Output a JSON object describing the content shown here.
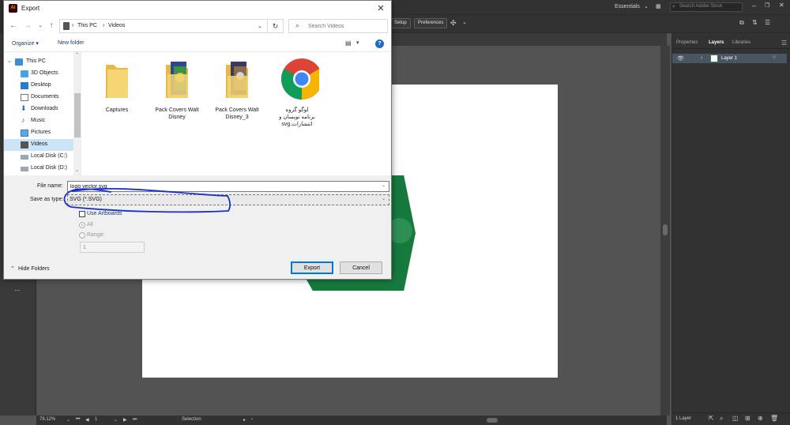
{
  "illustrator": {
    "workspace": "Essentials",
    "stock_search_placeholder": "Search Adobe Stock",
    "setup_btn": "Setup",
    "preferences_btn": "Preferences",
    "panel_tabs": [
      "Properties",
      "Layers",
      "Libraries"
    ],
    "layer_name": "Layer 1",
    "layer_count": "1 Layer",
    "zoom": "79.12%",
    "artboard_num": "1",
    "status_tool": "Selection",
    "toolbar_more": "...",
    "colors": {
      "shape_green": "#167a3e",
      "ui_dark": "#323232"
    }
  },
  "dialog": {
    "title": "Export",
    "close_glyph": "✕",
    "breadcrumb": [
      "This PC",
      "Videos"
    ],
    "search_placeholder": "Search Videos",
    "organize_label": "Organize ▾",
    "new_folder_label": "New folder",
    "help_glyph": "?",
    "nav_items": [
      {
        "label": "This PC",
        "icon": "computer-icon"
      },
      {
        "label": "3D Objects",
        "icon": "3d-objects-icon"
      },
      {
        "label": "Desktop",
        "icon": "desktop-icon"
      },
      {
        "label": "Documents",
        "icon": "documents-icon"
      },
      {
        "label": "Downloads",
        "icon": "downloads-icon"
      },
      {
        "label": "Music",
        "icon": "music-icon"
      },
      {
        "label": "Pictures",
        "icon": "pictures-icon"
      },
      {
        "label": "Videos",
        "icon": "videos-icon",
        "selected": true
      },
      {
        "label": "Local Disk (C:)",
        "icon": "drive-icon"
      },
      {
        "label": "Local Disk (D:)",
        "icon": "drive-icon"
      }
    ],
    "files": [
      {
        "name": "Captures",
        "icon": "folder-icon"
      },
      {
        "name": "Pack Covers Walt Disney",
        "icon": "folder-covers-icon"
      },
      {
        "name": "Pack Covers Walt Disney_3",
        "icon": "folder-covers-icon"
      },
      {
        "name": "لوگو گروه برنامه نویسان و انتشارات.svg",
        "icon": "chrome-icon"
      }
    ],
    "file_name_label": "File name:",
    "file_name_value": "logo vector.svg",
    "save_type_label": "Save as type:",
    "save_type_value": "SVG (*.SVG)",
    "use_artboards_label": "Use Artboards",
    "all_label": "All",
    "range_label": "Range:",
    "range_value": "1",
    "hide_folders_label": "Hide Folders",
    "export_label": "Export",
    "cancel_label": "Cancel",
    "annotation_color": "#1a2fd0"
  }
}
